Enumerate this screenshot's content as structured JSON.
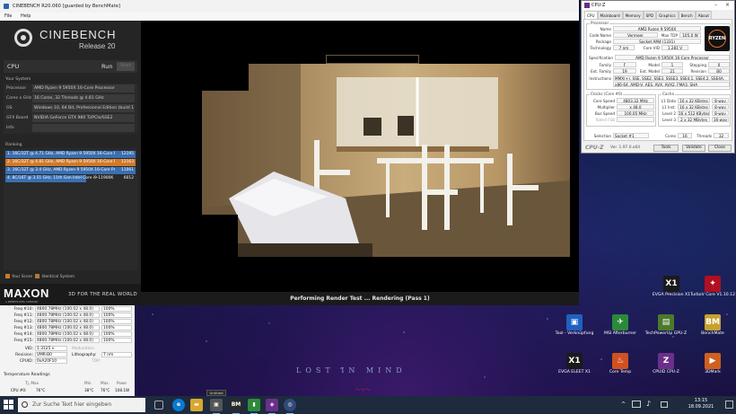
{
  "cinebench": {
    "title": "CINEBENCH R20.060 [guarded by BenchMate]",
    "menu": [
      "File",
      "Help"
    ],
    "logo_name": "CINEBENCH",
    "logo_release": "Release 20",
    "cpu_label": "CPU",
    "run_label": "Run",
    "run_button": "Start",
    "system_section": "Your System",
    "system": [
      {
        "key": "Processor",
        "value": "AMD Ryzen 9 5950X 16-Core Processor"
      },
      {
        "key": "Cores x GHz",
        "value": "16 Cores, 32 Threads @ 4.81 GHz"
      },
      {
        "key": "OS",
        "value": "Windows 10, 64 Bit, Professional Edition (build 1"
      },
      {
        "key": "GFX Board",
        "value": "NVIDIA GeForce GTX 980 Ti/PCIe/SSE2"
      },
      {
        "key": "Info",
        "value": ""
      }
    ],
    "ranking_section": "Ranking",
    "ranking": [
      {
        "name": "1. 16C/32T @ 4.71 GHz, AMD Ryzen 9 5950X 16-Core P",
        "score": "12195",
        "color": "#3a6fb0"
      },
      {
        "name": "2. 16C/32T @ 4.81 GHz, AMD Ryzen 9 5950X 16-Core P",
        "score": "12163",
        "color": "#d07a2a"
      },
      {
        "name": "3. 16C/32T @ 3.4 GHz, AMD Ryzen 9 5950X 16-Core Pr",
        "score": "11061",
        "color": "#3a6fb0"
      },
      {
        "name": "4. 8C/16T @ 3.51 GHz, 11th Gen Intel Core i9-11900K",
        "score": "6012",
        "color": "#3a6fb0"
      }
    ],
    "legend_your_score": "Your Score",
    "legend_identical": "Identical System",
    "maxon_logo": "MAXON",
    "maxon_sub": "A NEMETSCHEK COMPANY",
    "maxon_tagline": "3D FOR THE REAL WORLD",
    "render_status": "Performing Render Test ... Rendering (Pass 1)"
  },
  "cpuz": {
    "title": "CPU-Z",
    "tabs": [
      "CPU",
      "Mainboard",
      "Memory",
      "SPD",
      "Graphics",
      "Bench",
      "About"
    ],
    "processor_group": "Processor",
    "name_label": "Name",
    "name": "AMD Ryzen 9 5950X",
    "code_name_label": "Code Name",
    "code_name": "Vermeer",
    "max_tdp_label": "Max TDP",
    "max_tdp": "105.0 W",
    "package_label": "Package",
    "package": "Socket AM4 (1331)",
    "technology_label": "Technology",
    "technology": "7 nm",
    "core_vid_label": "Core VID",
    "core_vid": "1.281 V",
    "specification_label": "Specification",
    "specification": "AMD Ryzen 9 5950X 16-Core Processor",
    "family_label": "Family",
    "family": "F",
    "model_label": "Model",
    "model": "1",
    "stepping_label": "Stepping",
    "stepping": "0",
    "ext_family_label": "Ext. Family",
    "ext_family": "19",
    "ext_model_label": "Ext. Model",
    "ext_model": "21",
    "revision_label": "Revision",
    "revision": "B0",
    "instructions_label": "Instructions",
    "instructions_1": "MMX(+), SSE, SSE2, SSE3, SSSE3, SSE4.1, SSE4.2, SSE4A,",
    "instructions_2": "x86-64, AMD-V, AES, AVX, AVX2, FMA3, SHA",
    "clocks_group": "Clocks (Core #0)",
    "core_speed_label": "Core Speed",
    "core_speed": "4803.32 MHz",
    "multiplier_label": "Multiplier",
    "multiplier": "x 48.0",
    "bus_speed_label": "Bus Speed",
    "bus_speed": "100.05 MHz",
    "rated_fsb_label": "Rated FSB",
    "cache_group": "Cache",
    "l1d_label": "L1 Data",
    "l1d": "16 x 32 KBytes",
    "l1d_way": "8-way",
    "l1i_label": "L1 Inst.",
    "l1i": "16 x 32 KBytes",
    "l1i_way": "8-way",
    "l2_label": "Level 2",
    "l2": "16 x 512 KBytes",
    "l2_way": "8-way",
    "l3_label": "Level 3",
    "l3": "2 x 32 MBytes",
    "l3_way": "16-way",
    "selection_label": "Selection",
    "selection": "Socket #1",
    "cores_label": "Cores",
    "cores": "16",
    "threads_label": "Threads",
    "threads": "32",
    "brand": "CPU-Z",
    "version": "Ver. 1.97.0.x64",
    "tools_button": "Tools",
    "validate_button": "Validate",
    "close_button": "Close",
    "badge": "RYZEN"
  },
  "hwinfo": {
    "rows": [
      {
        "k": "Freq #10:",
        "v": "4800.78MHz (100.02 x 48.0)",
        "v2": "100%"
      },
      {
        "k": "Freq #11:",
        "v": "4800.78MHz (100.02 x 48.0)",
        "v2": "100%"
      },
      {
        "k": "Freq #12:",
        "v": "4800.78MHz (100.02 x 48.0)",
        "v2": "100%"
      },
      {
        "k": "Freq #13:",
        "v": "4800.78MHz (100.02 x 48.0)",
        "v2": "100%"
      },
      {
        "k": "Freq #14:",
        "v": "4800.78MHz (100.02 x 48.0)",
        "v2": "100%"
      },
      {
        "k": "Freq #15:",
        "v": "4800.78MHz (100.02 x 48.0)",
        "v2": "100%"
      }
    ],
    "vid_label": "VID:",
    "vid": "1.3125 v",
    "modulation_label": "Modulation:",
    "revision_label": "Revision:",
    "revision": "VMR-B0",
    "lithography_label": "Lithography:",
    "lithography": "7 nm",
    "cpuid_label": "CPUID:",
    "cpuid": "0xA20F10",
    "tdp_label": "TDP:",
    "temp_title": "Temperature Readings",
    "temp_headers": [
      "Tj, Max",
      "Min.",
      "Max.",
      "Powe"
    ],
    "temp_sensor": "CPU #0:",
    "temp_values": [
      "76°C",
      "38°C",
      "76°C",
      "108.1W"
    ]
  },
  "desktop": {
    "wallpaper_text": "LOST IN MIND",
    "icons": [
      {
        "label": "EVGA Precision X1",
        "glyph": "X1",
        "color": "#1a1a1a"
      },
      {
        "label": "TurboV Core V1.10.12",
        "glyph": "✦",
        "color": "#b01020"
      },
      {
        "label": "Tool - Verknüpfung",
        "glyph": "▣",
        "color": "#2060c0"
      },
      {
        "label": "MSI Afterburner",
        "glyph": "✈",
        "color": "#2a8a3a"
      },
      {
        "label": "TechPowerUp GPU-Z",
        "glyph": "▤",
        "color": "#4a7a2a"
      },
      {
        "label": "BenchMate",
        "glyph": "BM",
        "color": "#c8a030"
      },
      {
        "label": "EVGA ELEET X1",
        "glyph": "X1",
        "color": "#1a1a1a"
      },
      {
        "label": "Core Temp",
        "glyph": "♨",
        "color": "#d05020"
      },
      {
        "label": "CPUID CPU-Z",
        "glyph": "Z",
        "color": "#6a2f8a"
      },
      {
        "label": "3DMark",
        "glyph": "▶",
        "color": "#d06020"
      }
    ]
  },
  "taskbar": {
    "search_placeholder": "Zur Suche Text hier eingeben",
    "time": "13:15",
    "date": "18.09.2021",
    "tooltip": "Untitled",
    "apps": [
      {
        "name": "task-view",
        "glyph": "⧉",
        "color": "#1e2a3e"
      },
      {
        "name": "edge",
        "glyph": "e",
        "color": "#0a7ad0"
      },
      {
        "name": "file-explorer",
        "glyph": "▬",
        "color": "#d8a830"
      },
      {
        "name": "app-unknown",
        "glyph": "▣",
        "color": "#555"
      },
      {
        "name": "benchmate",
        "glyph": "BM",
        "color": "#2a2a2a"
      },
      {
        "name": "terminal",
        "glyph": "▮",
        "color": "#2f8a3a"
      },
      {
        "name": "cpuz",
        "glyph": "◈",
        "color": "#6a2f8a"
      },
      {
        "name": "hwinfo",
        "glyph": "◎",
        "color": "#304a7a"
      }
    ]
  }
}
